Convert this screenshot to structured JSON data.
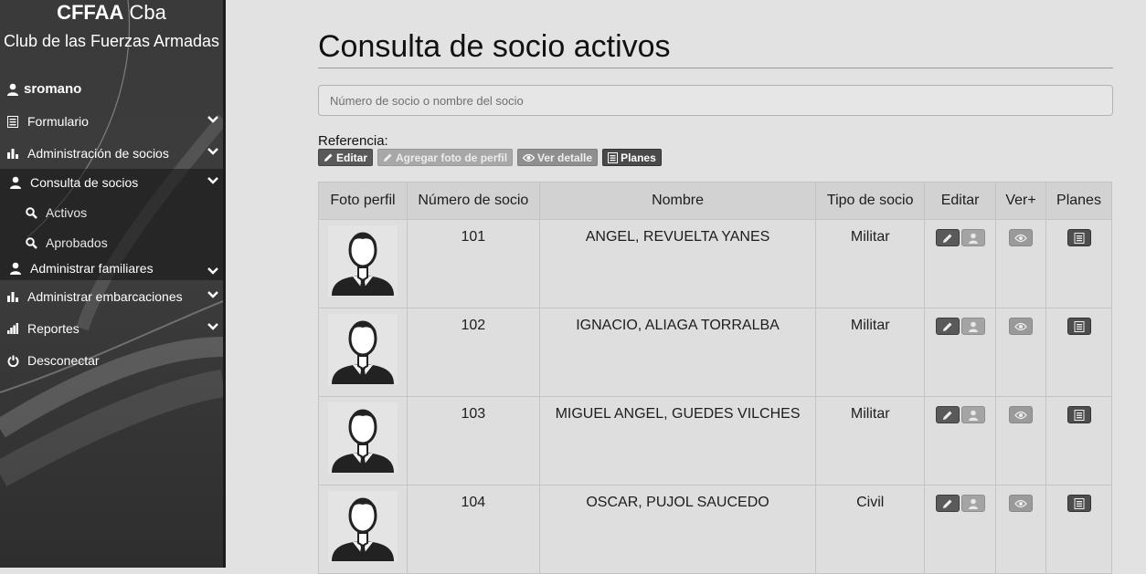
{
  "sidebar": {
    "brand_bold": "CFFAA",
    "brand_rest": " Cba",
    "brand_sub": "Club de las Fuerzas Armadas",
    "username": "sromano",
    "items": [
      {
        "label": "Formulario",
        "icon": "list-icon"
      },
      {
        "label": "Administración de socios",
        "icon": "bar-chart-icon"
      },
      {
        "label": "Consulta de socios",
        "icon": "user-icon"
      },
      {
        "label": "Activos",
        "icon": "search-icon"
      },
      {
        "label": "Aprobados",
        "icon": "search-icon"
      },
      {
        "label": "Administrar familiares",
        "icon": "user-icon"
      },
      {
        "label": "Administrar embarcaciones",
        "icon": "bar-chart-icon"
      },
      {
        "label": "Reportes",
        "icon": "signal-icon"
      },
      {
        "label": "Desconectar",
        "icon": "power-icon"
      }
    ]
  },
  "main": {
    "title": "Consulta de socio activos",
    "search_placeholder": "Número de socio o nombre del socio",
    "reference_label": "Referencia:",
    "legend": {
      "editar": "Editar",
      "agregar_foto": "Agregar foto de perfil",
      "ver_detalle": "Ver detalle",
      "planes": "Planes"
    },
    "table": {
      "headers": [
        "Foto perfil",
        "Número de socio",
        "Nombre",
        "Tipo de socio",
        "Editar",
        "Ver+",
        "Planes"
      ],
      "rows": [
        {
          "numero": "101",
          "nombre": "ANGEL, REVUELTA YANES",
          "tipo": "Militar"
        },
        {
          "numero": "102",
          "nombre": "IGNACIO, ALIAGA TORRALBA",
          "tipo": "Militar"
        },
        {
          "numero": "103",
          "nombre": "MIGUEL ANGEL, GUEDES VILCHES",
          "tipo": "Militar"
        },
        {
          "numero": "104",
          "nombre": "OSCAR, PUJOL SAUCEDO",
          "tipo": "Civil"
        }
      ]
    }
  }
}
